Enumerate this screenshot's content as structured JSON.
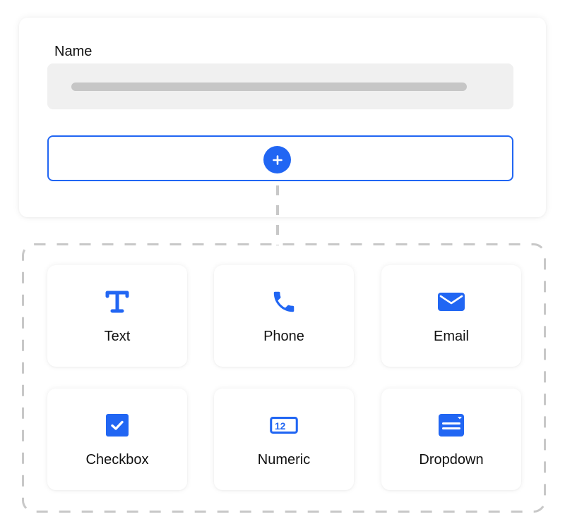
{
  "form": {
    "field_label": "Name",
    "add_button": {
      "icon": "plus-icon",
      "label": "+"
    }
  },
  "palette": {
    "items": [
      {
        "label": "Text",
        "icon": "text-icon"
      },
      {
        "label": "Phone",
        "icon": "phone-icon"
      },
      {
        "label": "Email",
        "icon": "email-icon"
      },
      {
        "label": "Checkbox",
        "icon": "checkbox-icon"
      },
      {
        "label": "Numeric",
        "icon": "numeric-icon",
        "icon_text": "12"
      },
      {
        "label": "Dropdown",
        "icon": "dropdown-icon"
      }
    ]
  },
  "colors": {
    "accent": "#2166f3",
    "input_bg": "#f0f0f0",
    "placeholder": "#c6c6c6",
    "dashed_border": "#c8c8c8"
  }
}
